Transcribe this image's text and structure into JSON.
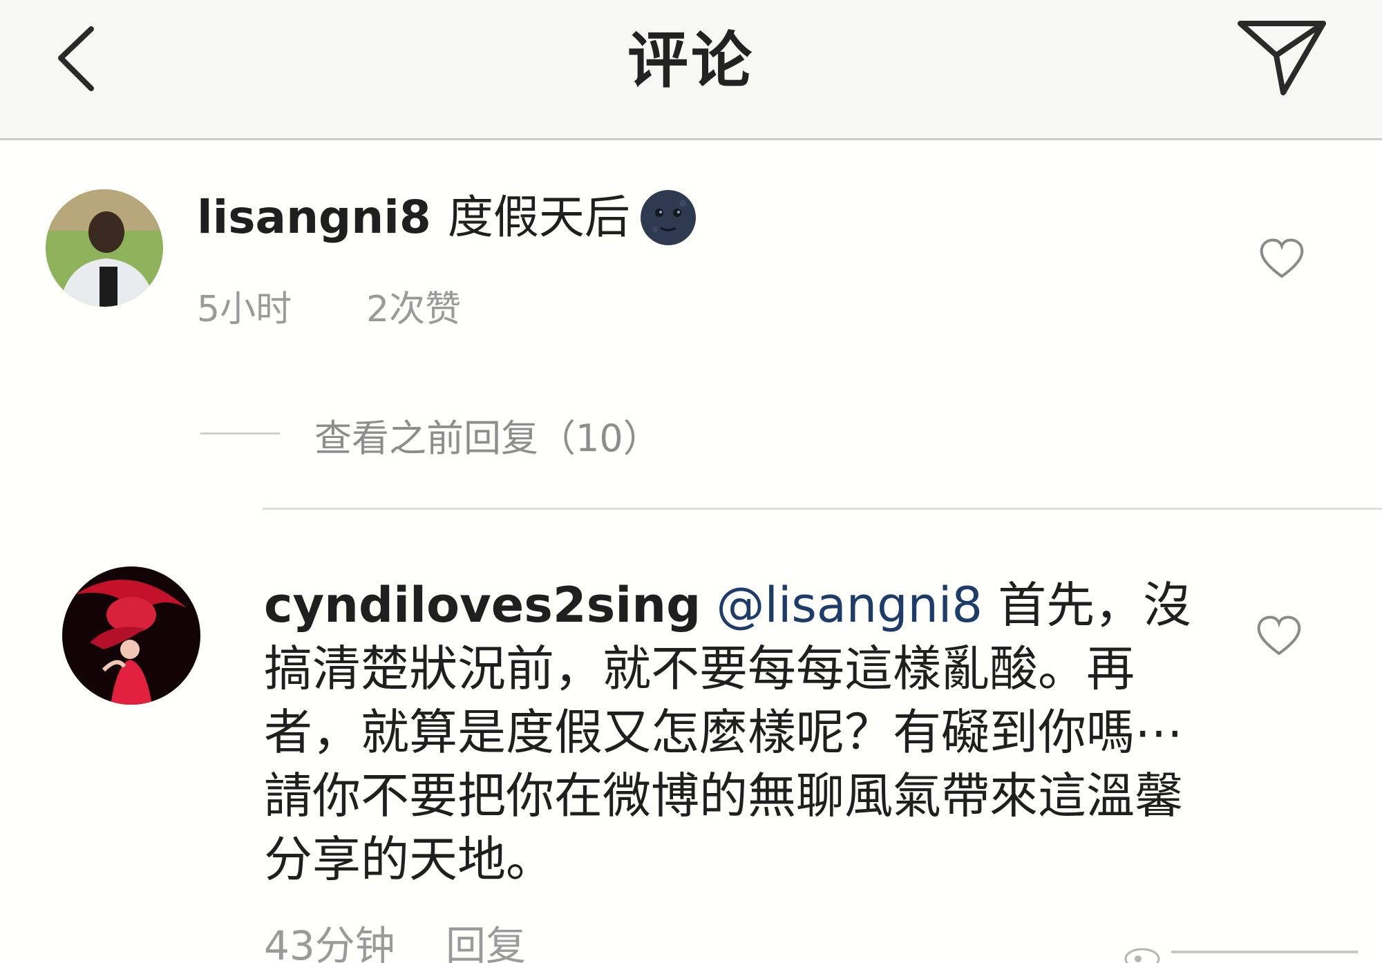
{
  "header": {
    "title": "评论",
    "back_icon": "chevron-left-icon",
    "share_icon": "paper-plane-icon"
  },
  "comments": [
    {
      "username": "lisangni8",
      "text": "度假天后",
      "emoji": "new-moon-face-emoji",
      "time": "5小时",
      "likes": "2次赞"
    },
    {
      "username": "cyndiloves2sing",
      "mention": "@lisangni8",
      "text": " 首先，沒搞清楚狀況前，就不要每每這樣亂酸。再者，就算是度假又怎麼樣呢？有礙到你嗎⋯ 請你不要把你在微博的無聊風氣帶來這溫馨分享的天地。",
      "time": "43分钟",
      "reply_label": "回复"
    }
  ],
  "view_replies": "查看之前回复（10）",
  "colors": {
    "mention": "#1d3c6a",
    "meta_text": "#9a9a9a",
    "header_bg": "#f8f8f5"
  }
}
